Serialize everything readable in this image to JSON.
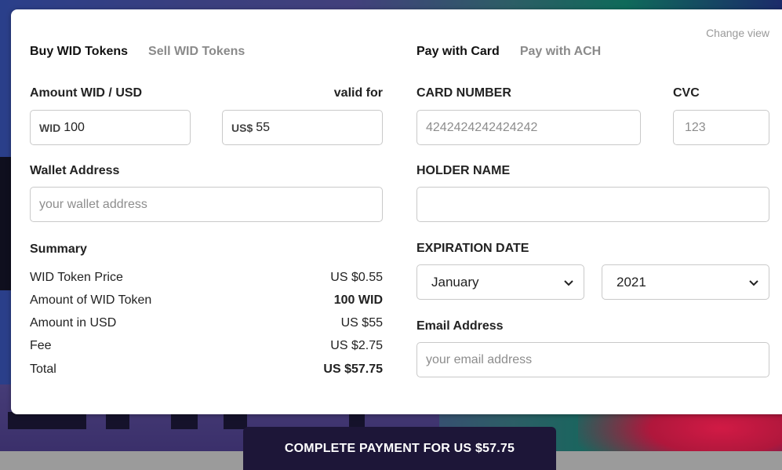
{
  "buy_section": {
    "tabs": [
      {
        "label": "Buy WID Tokens",
        "active": true
      },
      {
        "label": "Sell WID Tokens",
        "active": false
      }
    ],
    "amount_label": "Amount WID / USD",
    "valid_for_label": "valid for",
    "wid_prefix": "WID",
    "wid_value": "100",
    "usd_prefix": "US$",
    "usd_value": "55",
    "wallet_label": "Wallet Address",
    "wallet_placeholder": "your wallet address",
    "summary_title": "Summary",
    "summary": [
      {
        "label": "WID Token Price",
        "value": "US $0.55",
        "bold": false
      },
      {
        "label": "Amount of WID Token",
        "value": "100 WID",
        "bold": true
      },
      {
        "label": "Amount in USD",
        "value": "US $55",
        "bold": false
      },
      {
        "label": "Fee",
        "value": "US $2.75",
        "bold": false
      },
      {
        "label": "Total",
        "value": "US $57.75",
        "bold": true
      }
    ]
  },
  "pay_section": {
    "change_view": "Change view",
    "tabs": [
      {
        "label": "Pay with Card",
        "active": true
      },
      {
        "label": "Pay with ACH",
        "active": false
      }
    ],
    "card_number_label": "CARD NUMBER",
    "card_number_placeholder": "4242424242424242",
    "cvc_label": "CVC",
    "cvc_placeholder": "123",
    "holder_label": "HOLDER NAME",
    "holder_value": "",
    "expiration_label": "EXPIRATION DATE",
    "month_selected": "January",
    "year_selected": "2021",
    "email_label": "Email Address",
    "email_placeholder": "your email address"
  },
  "complete_button": "COMPLETE PAYMENT FOR US $57.75",
  "colors": {
    "button_bg": "#1d1638",
    "tab_inactive": "#8a8a8a",
    "border": "#c9c9c9"
  }
}
